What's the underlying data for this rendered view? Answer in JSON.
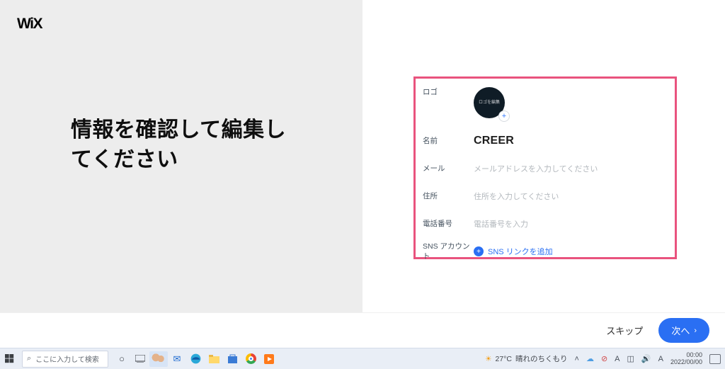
{
  "brand": "WiX",
  "headline": "情報を確認して編集してください",
  "form": {
    "logo_label": "ロゴ",
    "logo_placeholder_text": "ロゴを編集",
    "name_label": "名前",
    "name_value": "CREER",
    "email_label": "メール",
    "email_placeholder": "メールアドレスを入力してください",
    "address_label": "住所",
    "address_placeholder": "住所を入力してください",
    "phone_label": "電話番号",
    "phone_placeholder": "電話番号を入力",
    "sns_label": "SNS アカウント",
    "sns_link": "SNS リンクを追加"
  },
  "footer": {
    "skip": "スキップ",
    "next": "次へ"
  },
  "taskbar": {
    "search_placeholder": "ここに入力して検索",
    "weather_temp": "27°C",
    "weather_text": "晴れのちくもり",
    "time": "00:00",
    "date": "2022/00/00"
  }
}
